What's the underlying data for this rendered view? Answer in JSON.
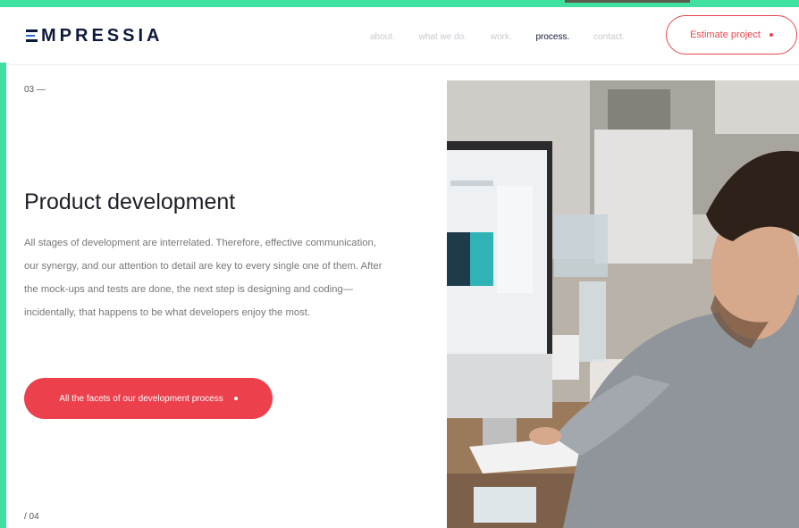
{
  "header": {
    "logo": "MPRESSIA",
    "nav": [
      {
        "label": "about."
      },
      {
        "label": "what we do."
      },
      {
        "label": "work."
      },
      {
        "label": "process."
      },
      {
        "label": "contact."
      }
    ],
    "estimate_label": "Estimate project"
  },
  "section": {
    "step": "03 —",
    "title": "Product development",
    "description": "All stages of development are interrelated. Therefore, effective communication, our synergy, and our attention to detail are key to every single one of them. After the mock-ups and tests are done, the next step is designing and coding—incidentally, that happens to be what developers enjoy the most.",
    "cta_label": "All the facets of our development process",
    "page_count": "/ 04"
  },
  "colors": {
    "accent": "#ec404d",
    "navy": "#0e1a3b",
    "frame": "#3fe0a0"
  }
}
